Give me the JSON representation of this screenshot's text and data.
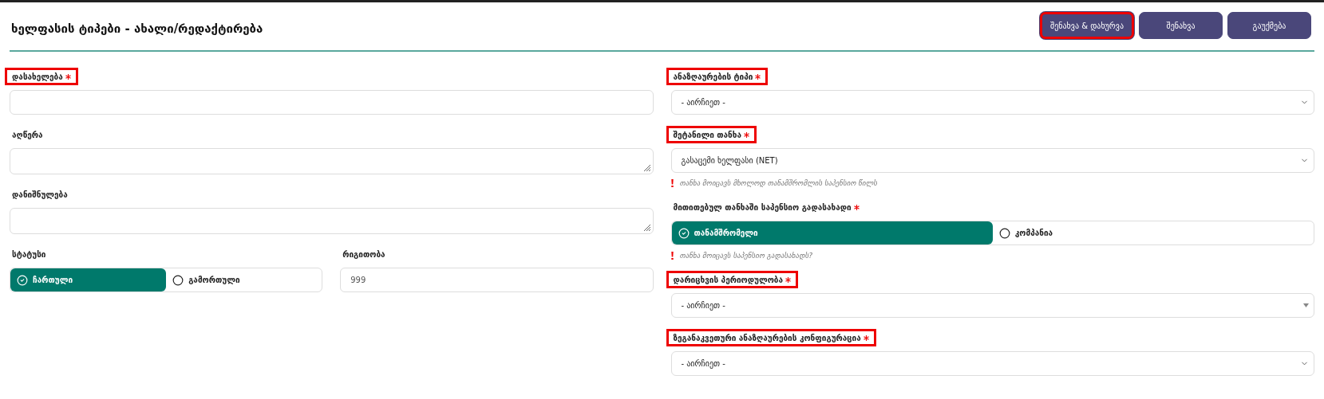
{
  "title": "ხელფასის ტიპები - ახალი/რედაქტირება",
  "buttons": [
    {
      "label": "შენახვა & დახურვა",
      "highlighted": true
    },
    {
      "label": "შენახვა",
      "highlighted": false
    },
    {
      "label": "გაუქმება",
      "highlighted": false
    }
  ],
  "left_rows": [
    [
      {
        "kind": "input",
        "label": "დასახელება",
        "required": true,
        "highlighted": true
      }
    ],
    [
      {
        "kind": "textarea",
        "label": "აღწერა",
        "required": false,
        "highlighted": false
      }
    ],
    [
      {
        "kind": "textarea",
        "label": "დანიშნულება",
        "required": false,
        "highlighted": false
      }
    ],
    [
      {
        "kind": "radio",
        "label": "სტატუსი",
        "required": false,
        "highlighted": false,
        "options": [
          {
            "label": "ჩართული",
            "selected": true
          },
          {
            "label": "გამორთული",
            "selected": false
          }
        ]
      },
      {
        "kind": "input",
        "label": "რიგითობა",
        "required": false,
        "highlighted": false,
        "value": "999"
      }
    ]
  ],
  "right_fields": [
    {
      "kind": "select",
      "label": "ანაზღაურების ტიპი",
      "required": true,
      "highlighted": true,
      "value": "- აირჩიეთ -"
    },
    {
      "kind": "select",
      "label": "შეტანილი თანხა",
      "required": true,
      "highlighted": true,
      "value": "გასაცემი ხელფასი (NET)",
      "hint": "თანხა მოიცავს მხოლოდ თანამშრომლის საპენსიო წილს"
    },
    {
      "kind": "radio",
      "label": "მითითებულ თანხაში საპენსიო გადასახადი",
      "required": true,
      "highlighted": false,
      "options": [
        {
          "label": "თანამშრომელი",
          "selected": true
        },
        {
          "label": "კომპანია",
          "selected": false
        }
      ],
      "hint": "თანხა მოიცავს საპენსიო გადასახადს?"
    },
    {
      "kind": "combobox",
      "label": "დარიცხვის პერიოდულობა",
      "required": true,
      "highlighted": true,
      "value": "- აირჩიეთ -"
    },
    {
      "kind": "select",
      "label": "ზეგანაკვეთური ანაზღაურების კონფიგურაცია",
      "required": true,
      "highlighted": true,
      "value": "- აირჩიეთ -"
    }
  ]
}
